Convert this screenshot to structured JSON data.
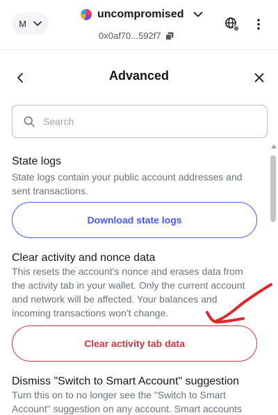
{
  "header": {
    "network_initial": "M",
    "account_name": "uncompromised",
    "account_address": "0x0af70...592f7"
  },
  "page": {
    "title": "Advanced"
  },
  "search": {
    "placeholder": "Search"
  },
  "sections": {
    "state_logs": {
      "title": "State logs",
      "description": "State logs contain your public account addresses and sent transactions.",
      "button_label": "Download state logs"
    },
    "clear_activity": {
      "title": "Clear activity and nonce data",
      "description": "This resets the account's nonce and erases data from the activity tab in your wallet. Only the current account and network will be affected. Your balances and incoming transactions won't change.",
      "button_label": "Clear activity tab data"
    },
    "smart_account": {
      "title": "Dismiss \"Switch to Smart Account\" suggestion",
      "description": "Turn this on to no longer see the \"Switch to Smart Account\" suggestion on any account. Smart accounts"
    }
  },
  "colors": {
    "primary": "#4459ff",
    "danger": "#ca3542",
    "annotation": "#e0262b"
  },
  "icons": [
    "chevron-down-icon",
    "copy-icon",
    "globe-icon",
    "more-vertical-icon",
    "back-arrow-icon",
    "close-icon",
    "search-icon"
  ]
}
